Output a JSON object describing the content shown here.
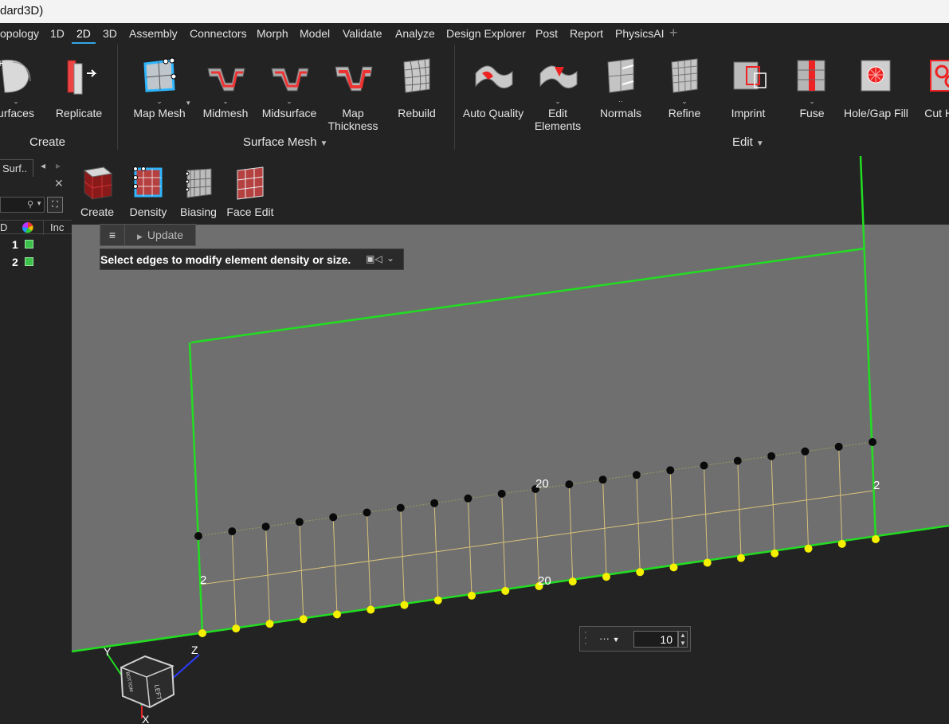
{
  "window": {
    "title": "dard3D)"
  },
  "menu": {
    "items": [
      "opology",
      "1D",
      "2D",
      "3D",
      "Assembly",
      "Connectors",
      "Morph",
      "Model",
      "Validate",
      "Analyze",
      "Design Explorer",
      "Post",
      "Report",
      "PhysicsAI"
    ],
    "active": "2D",
    "add_icon": "plus-icon"
  },
  "ribbon": {
    "create_group": {
      "label": "Create",
      "tools": [
        {
          "label": "urfaces",
          "icon": "surfaces-icon"
        },
        {
          "label": "Replicate",
          "icon": "replicate-icon"
        }
      ]
    },
    "surface_mesh_group": {
      "label": "Surface Mesh",
      "tools": [
        {
          "label": "Map Mesh",
          "icon": "map-mesh-icon"
        },
        {
          "label": "Midmesh",
          "icon": "midmesh-icon"
        },
        {
          "label": "Midsurface",
          "icon": "midsurface-icon"
        },
        {
          "label": "Map Thickness",
          "line1": "Map",
          "line2": "Thickness",
          "icon": "map-thickness-icon"
        },
        {
          "label": "Rebuild",
          "icon": "rebuild-icon"
        }
      ]
    },
    "edit_group": {
      "label": "Edit",
      "tools": [
        {
          "label": "Auto Quality",
          "icon": "auto-quality-icon"
        },
        {
          "label": "Edit Elements",
          "line1": "Edit",
          "line2": "Elements",
          "icon": "edit-elements-icon"
        },
        {
          "label": "Normals",
          "icon": "normals-icon"
        },
        {
          "label": "Refine",
          "icon": "refine-icon"
        },
        {
          "label": "Imprint",
          "icon": "imprint-icon"
        },
        {
          "label": "Fuse",
          "icon": "fuse-icon"
        },
        {
          "label": "Hole/Gap Fill",
          "icon": "hole-gap-fill-icon"
        },
        {
          "label": "Cut Ho",
          "icon": "cut-holes-icon"
        }
      ]
    }
  },
  "subtools": [
    {
      "label": "Create",
      "icon": "create-map-icon"
    },
    {
      "label": "Density",
      "icon": "density-icon"
    },
    {
      "label": "Biasing",
      "icon": "biasing-icon"
    },
    {
      "label": "Face Edit",
      "icon": "face-edit-icon"
    }
  ],
  "left_panel": {
    "tab": "Surf..",
    "columns": [
      "D",
      "Inc"
    ],
    "rows": [
      {
        "id": "1",
        "color": "#3cc24b"
      },
      {
        "id": "2",
        "color": "#3cc24b"
      }
    ]
  },
  "guide_bar": {
    "update_label": "Update"
  },
  "prompt": {
    "text": "Select edges to modify element density or size."
  },
  "micro_dialog": {
    "more": "···",
    "value": "10"
  },
  "viewport": {
    "colors": {
      "background": "#6f6f6f",
      "edge": "#22dd22",
      "mesh": "#d8c27a",
      "seed_top": "#0a0a0a",
      "seed_bottom": "#f5f000"
    },
    "edge_density_labels": {
      "top": "20",
      "bottom": "20",
      "left": "2",
      "right": "2"
    },
    "seed_count_per_edge": 20,
    "axis_labels": {
      "y": "Y",
      "z": "Z",
      "x": "X"
    },
    "view_cube": {
      "face_left": "LEFT",
      "face_bottom": "BOTTOM"
    }
  }
}
